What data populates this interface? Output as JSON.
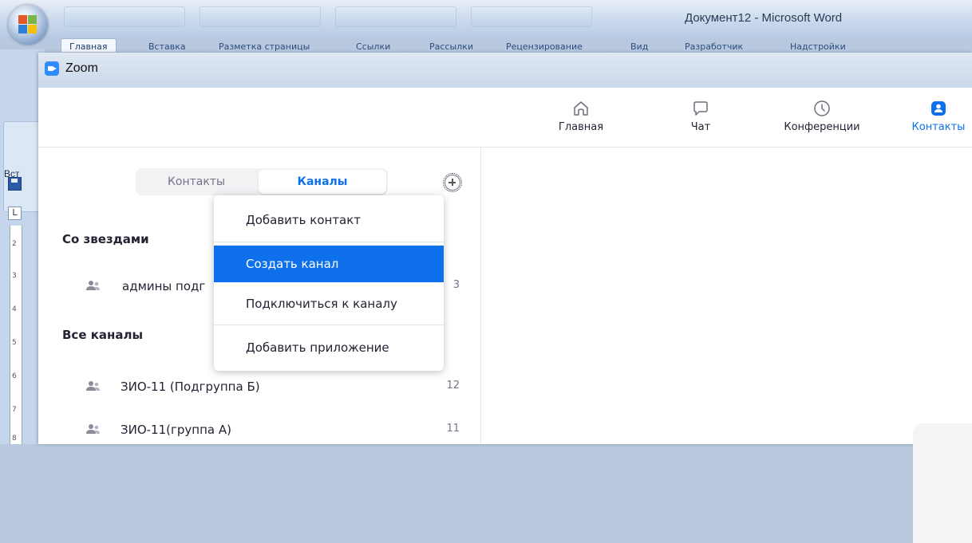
{
  "word": {
    "document_title": "Документ12 - Microsoft Word",
    "tabs": [
      "Главная",
      "Вставка",
      "Разметка страницы",
      "Ссылки",
      "Рассылки",
      "Рецензирование",
      "Вид",
      "Разработчик",
      "Надстройки"
    ],
    "paste_label": "Вст",
    "tabstop_glyph": "L",
    "ruler_numbers": [
      "2",
      "3",
      "4",
      "5",
      "6",
      "7",
      "8"
    ]
  },
  "zoom": {
    "window_title": "Zoom",
    "nav": {
      "home": "Главная",
      "chat": "Чат",
      "meetings": "Конференции",
      "contacts": "Контакты"
    },
    "tabs": {
      "contacts": "Контакты",
      "channels": "Каналы"
    },
    "sections": {
      "starred": "Со звездами",
      "all_channels": "Все каналы"
    },
    "starred_channels": [
      {
        "name": "админы подг",
        "count": "3"
      }
    ],
    "channels": [
      {
        "name": "ЗИО-11 (Подгруппа Б)",
        "count": "12"
      },
      {
        "name": "ЗИО-11(группа А)",
        "count": "11"
      }
    ],
    "menu": {
      "add_contact": "Добавить контакт",
      "create_channel": "Создать канал",
      "join_channel": "Подключиться к каналу",
      "add_app": "Добавить приложение"
    },
    "colors": {
      "accent": "#0e71eb",
      "text": "#232333",
      "muted": "#747487"
    }
  }
}
